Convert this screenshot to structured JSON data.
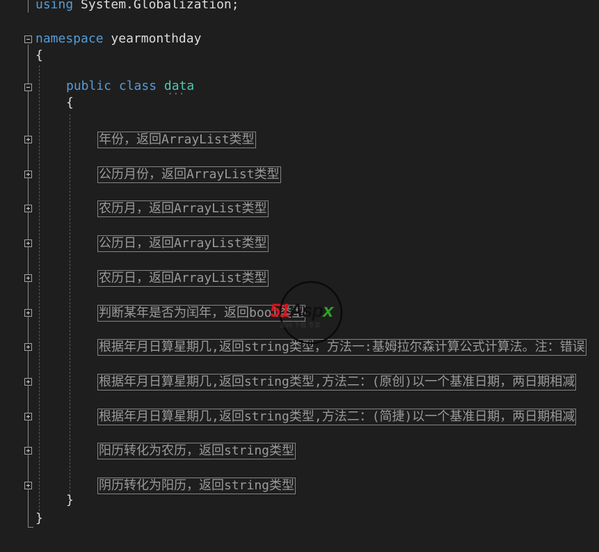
{
  "code": {
    "using_keyword": "using",
    "using_namespace": "System.Globalization;",
    "namespace_keyword": "namespace",
    "namespace_name": "yearmonthday",
    "open_brace": "{",
    "public_keyword": "public",
    "class_keyword": "class",
    "class_name": "data",
    "class_open_brace": "{",
    "class_close_brace": "}",
    "close_brace": "}",
    "collapsed_regions": [
      "年份，返回ArrayList类型",
      "公历月份，返回ArrayList类型",
      "农历月，返回ArrayList类型",
      "公历日，返回ArrayList类型",
      "农历日，返回ArrayList类型",
      "判断某年是否为闰年，返回bool类型",
      "根据年月日算星期几,返回string类型，方法一:基姆拉尔森计算公式计算法。注：错误",
      "根据年月日算星期几,返回string类型,方法二：(原创)以一个基准日期，两日期相减",
      "根据年月日算星期几,返回string类型,方法二：(简捷)以一个基准日期，两日期相减",
      "阳历转化为农历，返回string类型",
      "阴历转化为阳历，返回string类型"
    ]
  },
  "watermark": {
    "brand": "51Aspx",
    "tagline": "源码 下载 专家"
  },
  "colors": {
    "background": "#1e1e1e",
    "keyword": "#569cd6",
    "type": "#4ec9b0",
    "text": "#dcdcdc",
    "collapsed_text": "#9a9a9a"
  }
}
